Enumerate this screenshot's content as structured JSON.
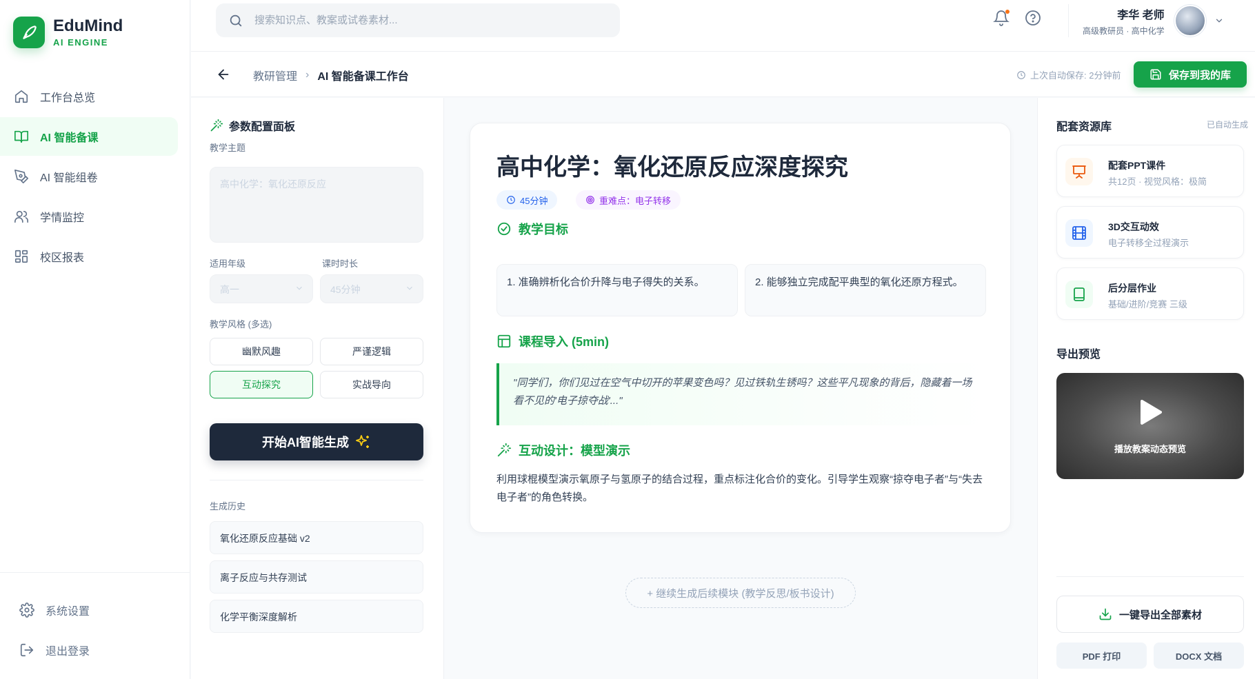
{
  "brand": {
    "name": "EduMind",
    "sub": "AI ENGINE"
  },
  "nav": {
    "items": [
      {
        "label": "工作台总览"
      },
      {
        "label": "AI 智能备课"
      },
      {
        "label": "AI 智能组卷"
      },
      {
        "label": "学情监控"
      },
      {
        "label": "校区报表"
      }
    ],
    "settings": "系统设置",
    "logout": "退出登录"
  },
  "search": {
    "placeholder": "搜索知识点、教案或试卷素材..."
  },
  "user": {
    "name": "李华 老师",
    "role": "高级教研员 · 高中化学"
  },
  "breadcrumb": {
    "parent": "教研管理",
    "current": "AI 智能备课工作台"
  },
  "autosave": "上次自动保存: 2分钟前",
  "save_button": "保存到我的库",
  "config": {
    "title": "参数配置面板",
    "topic_label": "教学主题",
    "topic_placeholder": "高中化学：氧化还原反应",
    "grade_label": "适用年级",
    "grade_value": "高一",
    "duration_label": "课时时长",
    "duration_value": "45分钟",
    "style_label": "教学风格 (多选)",
    "styles": [
      "幽默风趣",
      "严谨逻辑",
      "互动探究",
      "实战导向"
    ],
    "generate_button": "开始AI智能生成",
    "history_label": "生成历史",
    "history": [
      "氧化还原反应基础 v2",
      "离子反应与共存测试",
      "化学平衡深度解析"
    ]
  },
  "lesson": {
    "title": "高中化学：氧化还原反应深度探究",
    "duration_tag": "45分钟",
    "key_tag": "重难点：电子转移",
    "objectives_heading": "教学目标",
    "objectives": [
      "1. 准确辨析化合价升降与电子得失的关系。",
      "2. 能够独立完成配平典型的氧化还原方程式。"
    ],
    "intro_heading": "课程导入 (5min)",
    "intro_quote": "\"同学们，你们见过在空气中切开的苹果变色吗？见过铁轨生锈吗？这些平凡现象的背后，隐藏着一场看不见的'电子掠夺战'...\"",
    "design_heading": "互动设计：模型演示",
    "design_text": "利用球棍模型演示氧原子与氢原子的结合过程，重点标注化合价的变化。引导学生观察“掠夺电子者”与“失去电子者”的角色转换。",
    "continue_button": "+ 继续生成后续模块 (教学反思/板书设计)"
  },
  "resources": {
    "title": "配套资源库",
    "auto_label": "已自动生成",
    "items": [
      {
        "title": "配套PPT课件",
        "sub": "共12页 · 视觉风格：极简",
        "icon": "presentation-icon",
        "color": "#ea580c"
      },
      {
        "title": "3D交互动效",
        "sub": "电子转移全过程演示",
        "icon": "film-icon",
        "color": "#2563eb"
      },
      {
        "title": "后分层作业",
        "sub": "基础/进阶/竞赛 三级",
        "icon": "book-icon",
        "color": "#16a34a"
      }
    ],
    "preview_title": "导出预览",
    "preview_label": "播放教案动态预览",
    "export_all": "一键导出全部素材",
    "pdf": "PDF 打印",
    "docx": "DOCX 文档"
  },
  "colors": {
    "accent": "#16a34a",
    "dark": "#1e293b",
    "blue": "#2563eb",
    "purple": "#9333ea",
    "orange": "#ea580c"
  }
}
